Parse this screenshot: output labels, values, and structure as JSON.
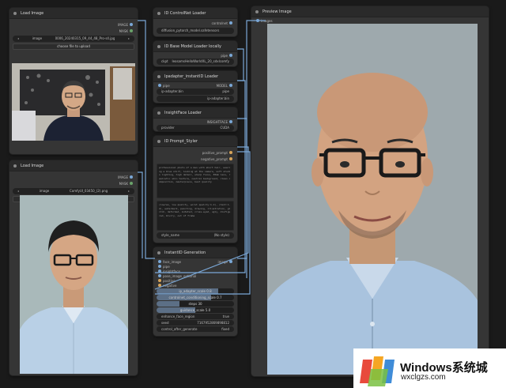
{
  "nodes": {
    "load_image_1": {
      "title": "Load Image",
      "outputs": [
        "IMAGE",
        "MASK"
      ],
      "image_widget_label": "image",
      "image_widget_value": "0006_20240315_09_44_48_Pro-s4.jpg",
      "upload_label": "choose file to upload"
    },
    "load_image_2": {
      "title": "Load Image",
      "outputs": [
        "IMAGE",
        "MASK"
      ],
      "image_widget_label": "image",
      "image_widget_value": "ComfyUI_03450_(2).png",
      "upload_label": "choose file to upload"
    },
    "controlnet_loader": {
      "title": "ID ControlNet Loader",
      "output": "controlnet",
      "widget_value": "diffusion_pytorch_model.safetensors"
    },
    "model_loader": {
      "title": "ID Base Model Loader locally",
      "outputs": [
        "pipe"
      ],
      "widget_label": "ckpt",
      "widget_value": "leosamsHelloWorldXL_20_sdxlcomfy"
    },
    "insightface_loader": {
      "title": "Ipadapter_instantID Loader",
      "inputs": [
        "pipe"
      ],
      "outputs": [
        "MODEL",
        "pipe"
      ],
      "widget_value": "ip-adapter.bin",
      "widget2_value": "ip-adapter.bin"
    },
    "face_loader": {
      "title": "InsightFace Loader",
      "output": "INSIGHTFACE",
      "widget_label": "provider",
      "widget_value": "CUDA"
    },
    "prompt_styler": {
      "title": "ID Prompt_Styler",
      "outputs": [
        "positive_prompt",
        "negative_prompt"
      ],
      "positive_text": "professional photo of a man with short hair, wearing a blue shirt, looking at the camera, soft studio lighting, high detail, sharp focus, 85mm lens, realistic skin texture, neutral background, clean composition, masterpiece, best quality",
      "negative_text": "(lowres, low quality, worst quality:1.2), (text:1.2), watermark, painting, drawing, illustration, glitch, deformed, mutated, cross-eyed, ugly, disfigured, blurry, out of frame",
      "style_label": "style_name",
      "style_value": "(No style)"
    },
    "generation": {
      "title": "InstantID Generation",
      "inputs": [
        "face_image",
        "pipe",
        "insightface",
        "pose_image_optional",
        "positive",
        "negative"
      ],
      "output": "image",
      "sliders": [
        {
          "text": "ip_adapter_scale  0.8",
          "fill": 0.8
        },
        {
          "text": "controlnet_conditioning_scale  0.7",
          "fill": 0.7
        },
        {
          "text": "steps  30",
          "fill": 0.3
        },
        {
          "text": "guidance_scale  5.0",
          "fill": 0.5
        }
      ],
      "widgets": [
        {
          "label": "enhance_face_region",
          "value": "true"
        },
        {
          "label": "seed",
          "value": "7167952869898812"
        },
        {
          "label": "control_after_generate",
          "value": "fixed"
        }
      ]
    },
    "preview": {
      "title": "Preview Image",
      "input": "images"
    }
  },
  "watermark": {
    "title": "Windows系统城",
    "subtitle": "wxclgzs.com"
  },
  "colors": {
    "canvas": "#1a1a1a",
    "node": "#353535",
    "wire": "#7aa7d6"
  }
}
